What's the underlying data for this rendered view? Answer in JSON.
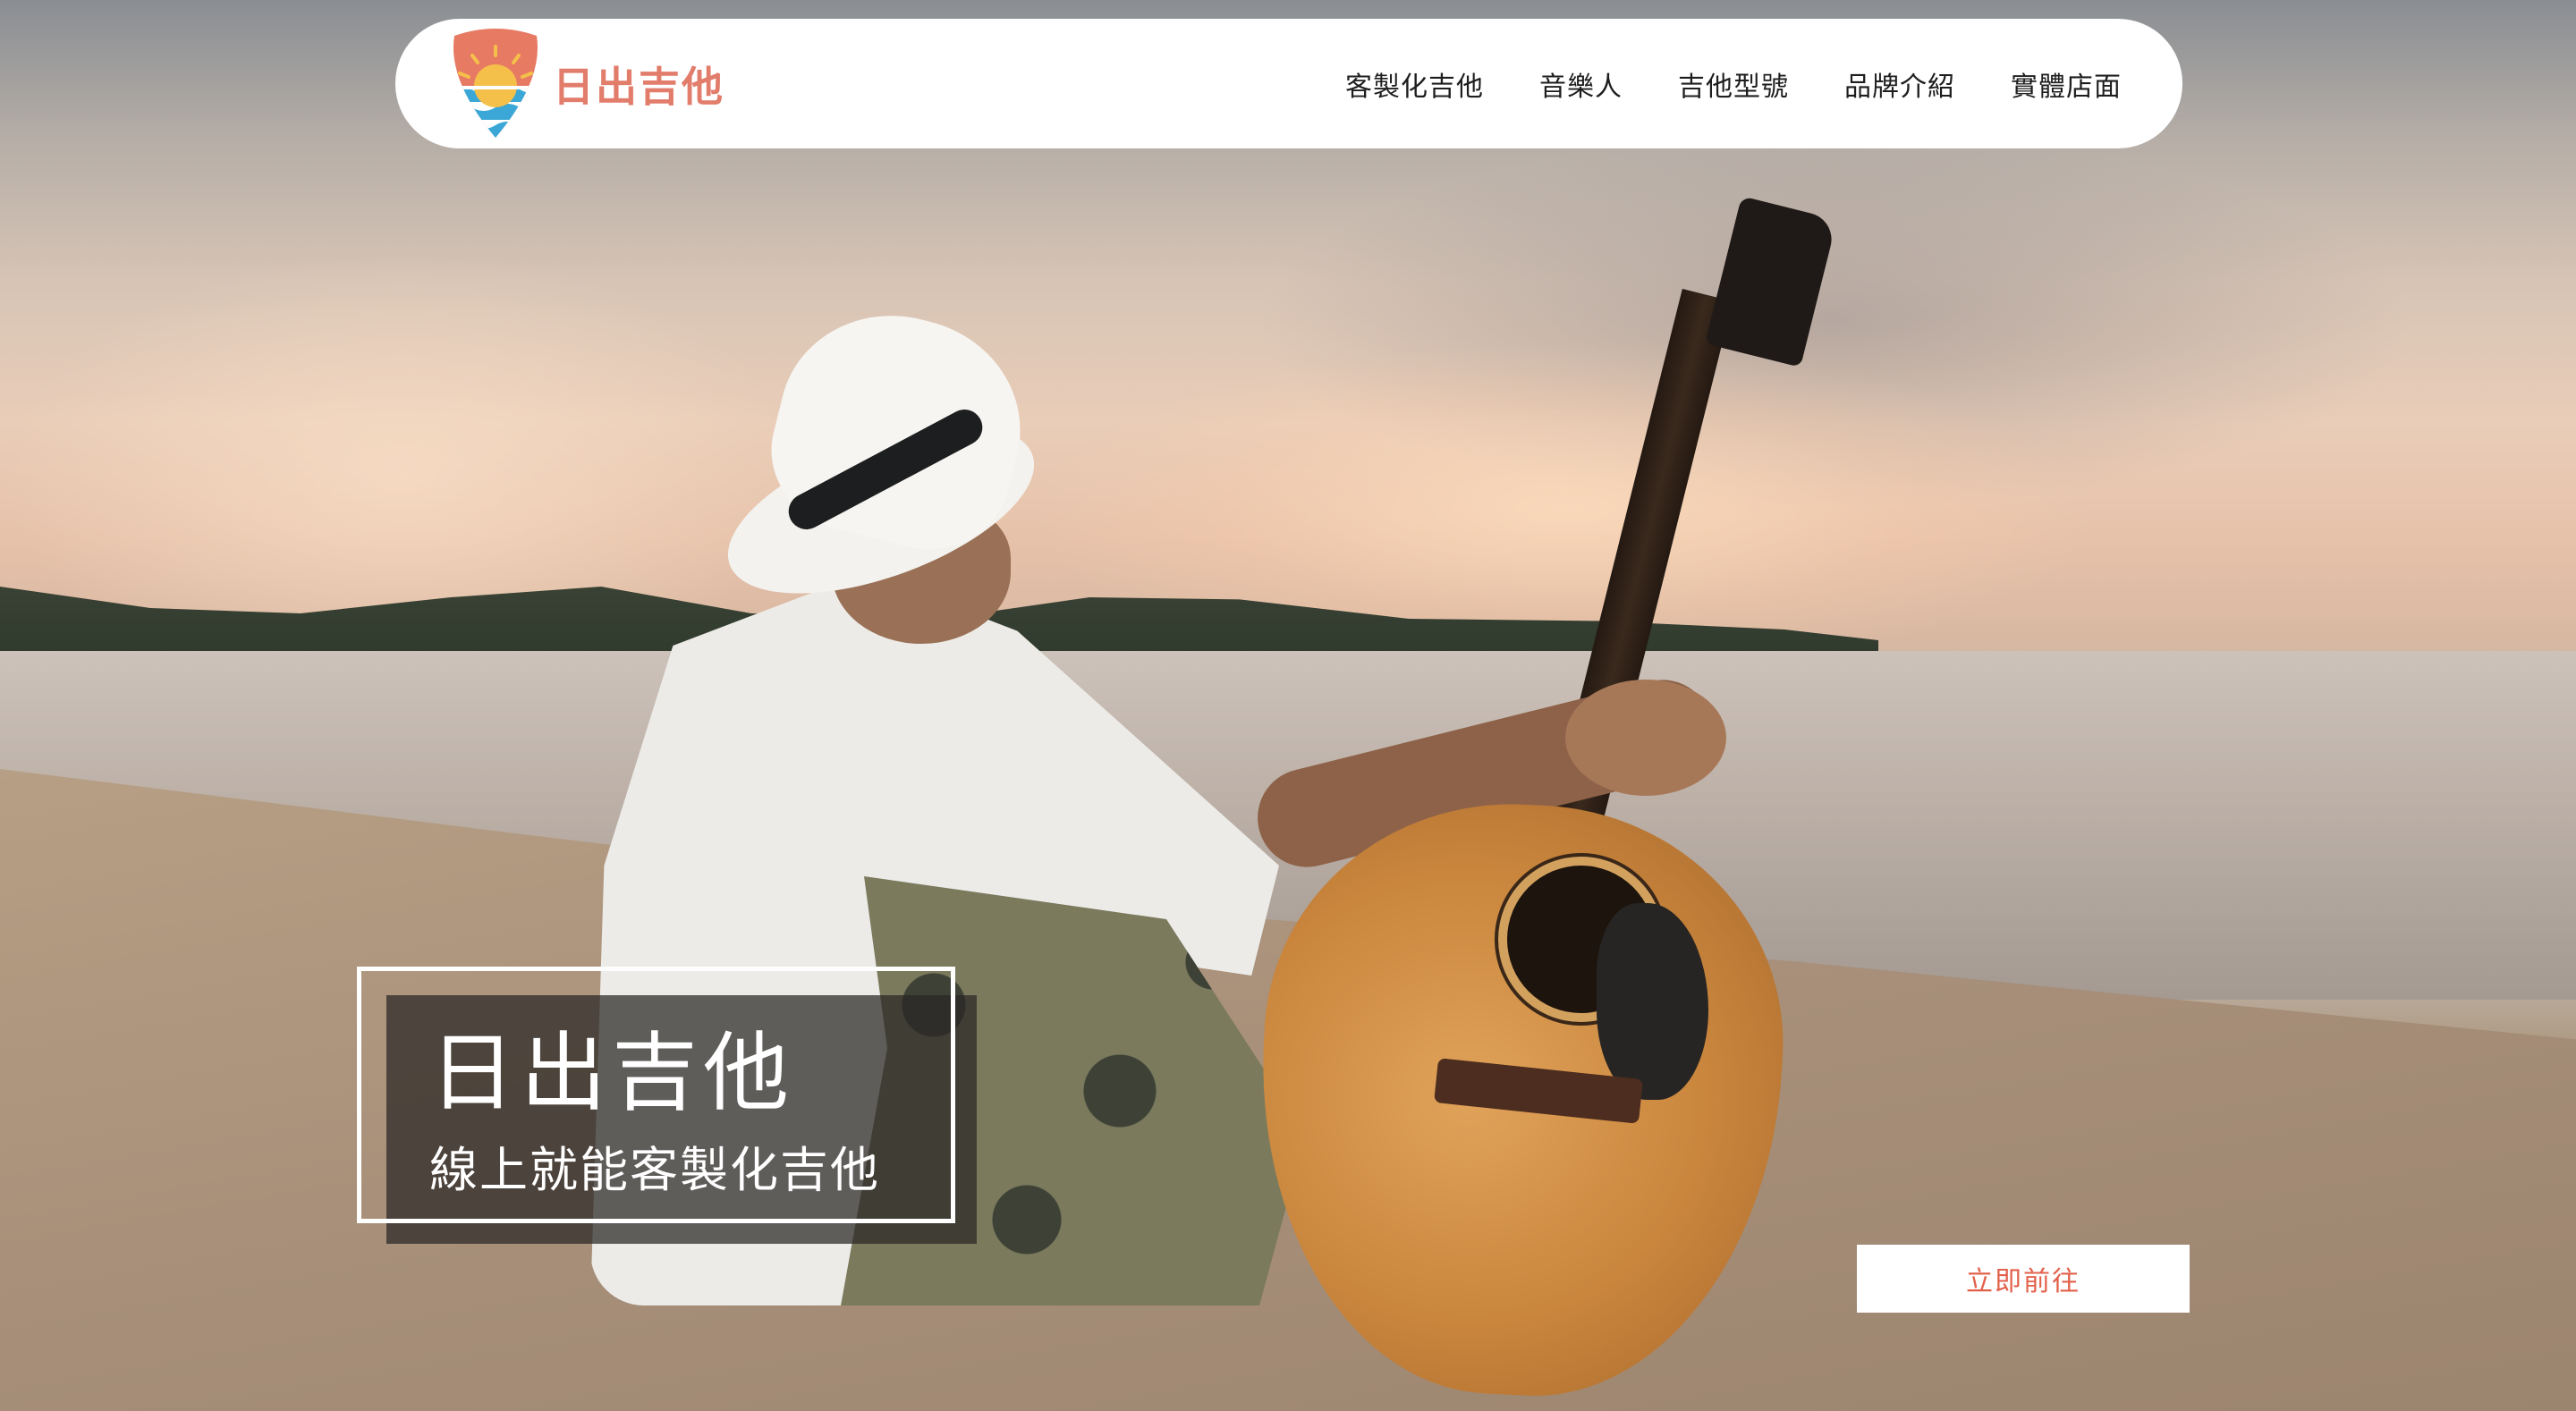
{
  "brand": {
    "name": "日出吉他",
    "accent_color": "#e27c6b",
    "logo_icon": "sunrise-waves-pick-icon"
  },
  "nav": {
    "items": [
      {
        "label": "客製化吉他"
      },
      {
        "label": "音樂人"
      },
      {
        "label": "吉他型號"
      },
      {
        "label": "品牌介紹"
      },
      {
        "label": "實體店面"
      }
    ]
  },
  "hero": {
    "title": "日出吉他",
    "subtitle": "線上就能客製化吉他",
    "cta_label": "立即前往",
    "cta_color": "#e2614b"
  }
}
